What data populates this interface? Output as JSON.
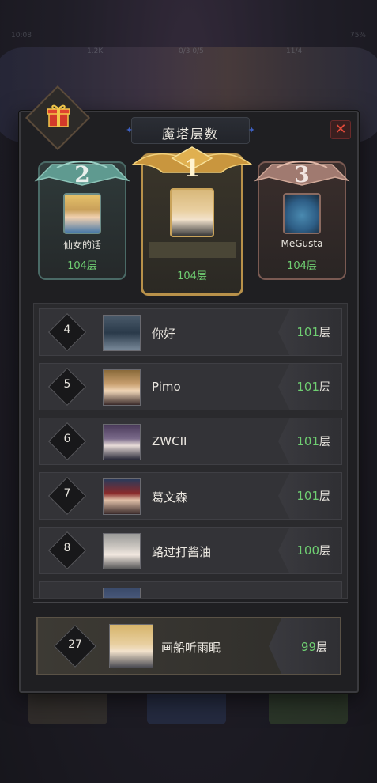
{
  "window": {
    "title": "魔塔层数"
  },
  "status_bar": {
    "time": "10:08",
    "battery": "75%"
  },
  "resources": [
    "1.2K",
    "0/3 0/5",
    "11/4"
  ],
  "podium": [
    {
      "rank": "2",
      "name": "仙女的话",
      "floor": "104层",
      "avatar_icon": "blonde-elf-avatar"
    },
    {
      "rank": "1",
      "name": "",
      "floor": "104层",
      "avatar_icon": "golden-hair-hero-avatar"
    },
    {
      "rank": "3",
      "name": "MeGusta",
      "floor": "104层",
      "avatar_icon": "blue-goblin-avatar"
    }
  ],
  "list": [
    {
      "rank": "4",
      "name": "你好",
      "floor_value": "101",
      "floor_unit": "层",
      "avatar_icon": "armored-knight-avatar"
    },
    {
      "rank": "5",
      "name": "Pimo",
      "floor_value": "101",
      "floor_unit": "层",
      "avatar_icon": "brunette-hero-avatar"
    },
    {
      "rank": "6",
      "name": "ZWCII",
      "floor_value": "101",
      "floor_unit": "层",
      "avatar_icon": "hooded-girl-avatar"
    },
    {
      "rank": "7",
      "name": "葛文森",
      "floor_value": "101",
      "floor_unit": "层",
      "avatar_icon": "red-hair-captain-avatar"
    },
    {
      "rank": "8",
      "name": "路过打酱油",
      "floor_value": "100",
      "floor_unit": "层",
      "avatar_icon": "silver-hair-girl-avatar"
    }
  ],
  "self": {
    "rank": "27",
    "name": "画船听雨眠",
    "floor_value": "99",
    "floor_unit": "层",
    "avatar_icon": "blonde-knight-avatar"
  },
  "colors": {
    "floor_green": "#6fcf72",
    "close_red": "#e04a3a",
    "gold": "#d9a441",
    "silver": "#6fa39a",
    "bronze": "#b08478"
  }
}
